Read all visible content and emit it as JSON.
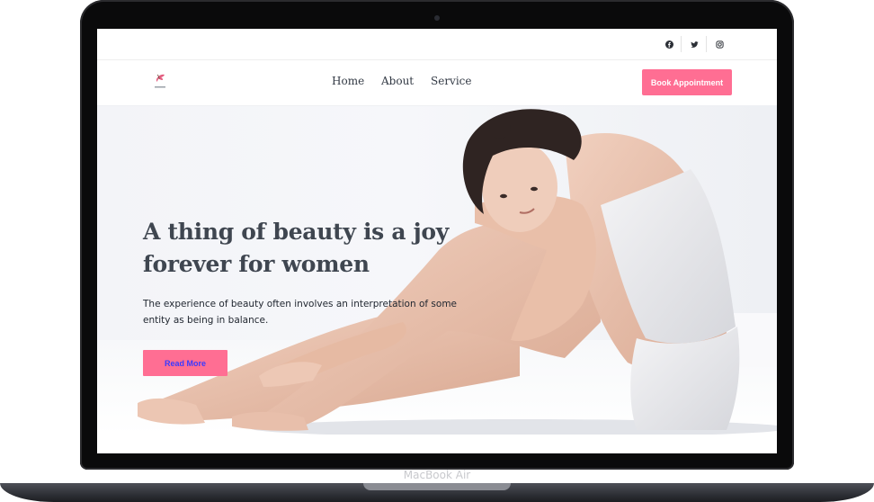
{
  "device": {
    "label": "MacBook Air"
  },
  "topbar": {
    "social": [
      {
        "icon": "facebook-icon"
      },
      {
        "icon": "twitter-icon"
      },
      {
        "icon": "instagram-icon"
      }
    ]
  },
  "nav": {
    "links": [
      "Home",
      "About",
      "Service"
    ],
    "cta": "Book Appointment"
  },
  "hero": {
    "title": "A thing of beauty is a joy forever for women",
    "description": "The experience of beauty often involves an interpretation of some entity as being in balance.",
    "button": "Read More"
  },
  "colors": {
    "accent": "#ff6e93",
    "heading": "#3f4650",
    "button_text": "#3a3aff"
  }
}
